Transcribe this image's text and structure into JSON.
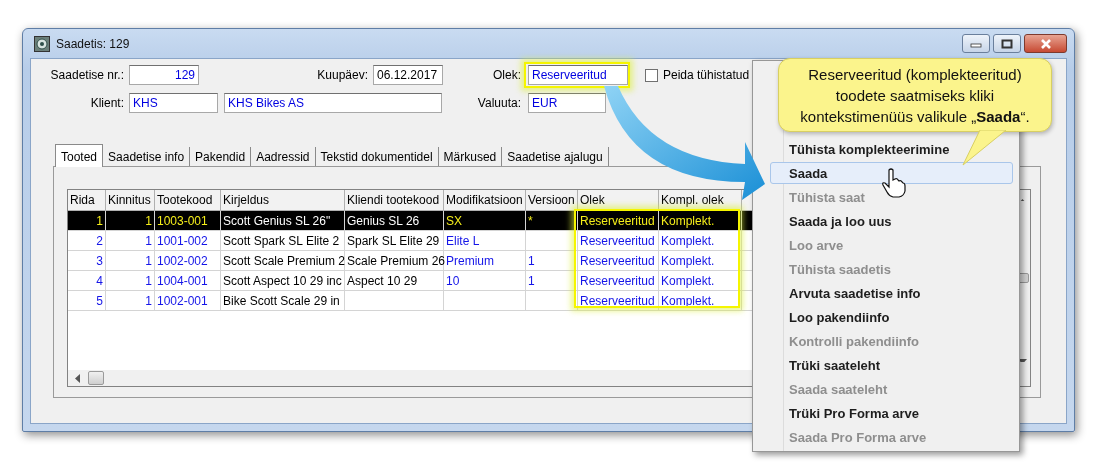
{
  "window": {
    "title": "Saadetis: 129"
  },
  "shipment_no": {
    "label": "Saadetise nr.:",
    "value": "129"
  },
  "date": {
    "label": "Kuupäev:",
    "value": "06.12.2017"
  },
  "status": {
    "label": "Olek:",
    "value": "Reserveeritud"
  },
  "hide_cancelled": {
    "label": "Peida tühistatud",
    "checked": false
  },
  "client": {
    "label": "Klient:",
    "code": "KHS",
    "name": "KHS Bikes AS"
  },
  "currency": {
    "label": "Valuuta:",
    "value": "EUR"
  },
  "tabs": [
    {
      "label": "Tooted",
      "selected": true
    },
    {
      "label": "Saadetise info",
      "selected": false
    },
    {
      "label": "Pakendid",
      "selected": false
    },
    {
      "label": "Aadressid",
      "selected": false
    },
    {
      "label": "Tekstid dokumentidel",
      "selected": false
    },
    {
      "label": "Märkused",
      "selected": false
    },
    {
      "label": "Saadetise ajalugu",
      "selected": false
    }
  ],
  "table": {
    "columns": [
      "Rida",
      "Kinnitus",
      "Tootekood",
      "Kirjeldus",
      "Kliendi tootekood",
      "Modifikatsioon",
      "Versioon",
      "Olek",
      "Kompl. olek"
    ],
    "rows": [
      {
        "selected": true,
        "cells": [
          "1",
          "1",
          "1003-001",
          "Scott Genius SL 26\"",
          "Genius SL 26",
          "SX",
          "*",
          "Reserveeritud",
          "Komplekt."
        ]
      },
      {
        "selected": false,
        "cells": [
          "2",
          "1",
          "1001-002",
          "Scott Spark SL Elite 2",
          "Spark SL Elite 29",
          "Elite L",
          null,
          "Reserveeritud",
          "Komplekt."
        ]
      },
      {
        "selected": false,
        "cells": [
          "3",
          "1",
          "1002-002",
          "Scott Scale Premium 2",
          "Scale Premium 26",
          "Premium",
          "1",
          "Reserveeritud",
          "Komplekt."
        ]
      },
      {
        "selected": false,
        "cells": [
          "4",
          "1",
          "1004-001",
          "Scott Aspect 10 29 inc",
          "Aspect 10 29",
          "10",
          "1",
          "Reserveeritud",
          "Komplekt."
        ]
      },
      {
        "selected": false,
        "cells": [
          "5",
          "1",
          "1002-001",
          "Bike Scott Scale 29 in",
          null,
          null,
          null,
          "Reserveeritud",
          "Komplekt."
        ]
      }
    ]
  },
  "context_menu": {
    "items": [
      {
        "label": "Tühista komplekteerimine",
        "disabled": false,
        "selected": false
      },
      {
        "label": "Saada",
        "disabled": false,
        "selected": true
      },
      {
        "label": "Tühista saat",
        "disabled": true,
        "selected": false
      },
      {
        "label": "Saada ja loo uus",
        "disabled": false,
        "selected": false
      },
      {
        "label": "Loo arve",
        "disabled": true,
        "selected": false
      },
      {
        "label": "Tühista saadetis",
        "disabled": true,
        "selected": false
      },
      {
        "label": "Arvuta saadetise info",
        "disabled": false,
        "selected": false
      },
      {
        "label": "Loo pakendiinfo",
        "disabled": false,
        "selected": false
      },
      {
        "label": "Kontrolli pakendiinfo",
        "disabled": true,
        "selected": false
      },
      {
        "label": "Trüki saateleht",
        "disabled": false,
        "selected": false
      },
      {
        "label": "Saada saateleht",
        "disabled": true,
        "selected": false
      },
      {
        "label": "Trüki Pro Forma arve",
        "disabled": false,
        "selected": false
      },
      {
        "label": "Saada Pro Forma arve",
        "disabled": true,
        "selected": false
      }
    ]
  },
  "callout": {
    "lines": [
      "Reserveeritud (komplekteeritud)",
      "toodete saatmiseks kliki",
      "kontekstimenüüs valikule „**Saada**“."
    ]
  }
}
